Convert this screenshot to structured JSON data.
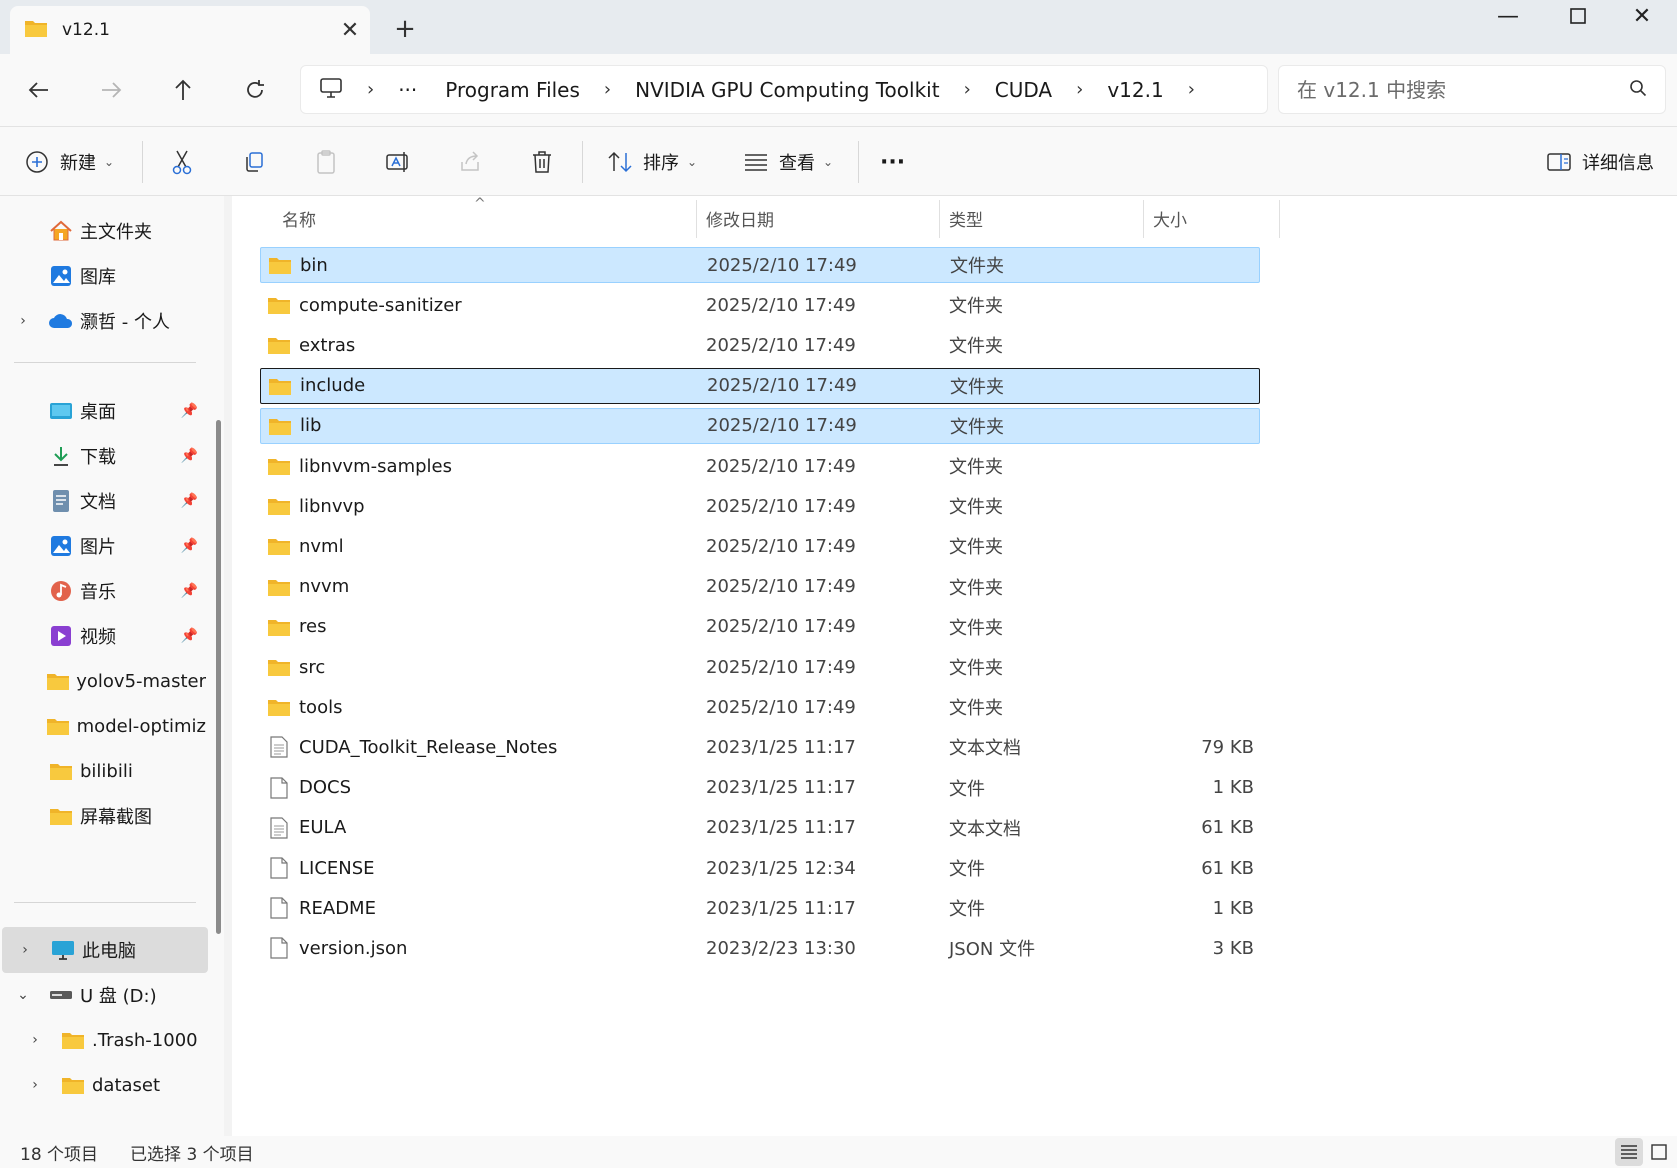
{
  "tab": {
    "title": "v12.1"
  },
  "address": {
    "crumbs": [
      "Program Files",
      "NVIDIA GPU Computing Toolkit",
      "CUDA",
      "v12.1"
    ],
    "ellipsis": "···"
  },
  "search": {
    "placeholder": "在 v12.1 中搜索"
  },
  "toolbar": {
    "new_label": "新建",
    "sort_label": "排序",
    "view_label": "查看",
    "more_label": "···",
    "details_label": "详细信息"
  },
  "sidebar": {
    "top": [
      {
        "label": "主文件夹",
        "icon": "home-icon"
      },
      {
        "label": "图库",
        "icon": "gallery-icon"
      },
      {
        "label": "灏哲 - 个人",
        "icon": "onedrive-icon"
      }
    ],
    "pinned": [
      {
        "label": "桌面",
        "icon": "desktop-icon"
      },
      {
        "label": "下载",
        "icon": "download-icon"
      },
      {
        "label": "文档",
        "icon": "documents-icon"
      },
      {
        "label": "图片",
        "icon": "pictures-icon"
      },
      {
        "label": "音乐",
        "icon": "music-icon"
      },
      {
        "label": "视频",
        "icon": "videos-icon"
      }
    ],
    "folders": [
      "yolov5-master",
      "model-optimiz",
      "bilibili",
      "屏幕截图"
    ],
    "drives": [
      {
        "label": "此电脑",
        "icon": "this-pc-icon"
      },
      {
        "label": "U 盘 (D:)",
        "icon": "usb-drive-icon"
      }
    ],
    "drive_children": [
      ".Trash-1000",
      "dataset"
    ]
  },
  "columns": {
    "name": "名称",
    "date": "修改日期",
    "type": "类型",
    "size": "大小"
  },
  "files": [
    {
      "name": "bin",
      "date": "2025/2/10 17:49",
      "type": "文件夹",
      "size": "",
      "kind": "folder",
      "state": "selected"
    },
    {
      "name": "compute-sanitizer",
      "date": "2025/2/10 17:49",
      "type": "文件夹",
      "size": "",
      "kind": "folder",
      "state": ""
    },
    {
      "name": "extras",
      "date": "2025/2/10 17:49",
      "type": "文件夹",
      "size": "",
      "kind": "folder",
      "state": ""
    },
    {
      "name": "include",
      "date": "2025/2/10 17:49",
      "type": "文件夹",
      "size": "",
      "kind": "folder",
      "state": "focused"
    },
    {
      "name": "lib",
      "date": "2025/2/10 17:49",
      "type": "文件夹",
      "size": "",
      "kind": "folder",
      "state": "selected"
    },
    {
      "name": "libnvvm-samples",
      "date": "2025/2/10 17:49",
      "type": "文件夹",
      "size": "",
      "kind": "folder",
      "state": ""
    },
    {
      "name": "libnvvp",
      "date": "2025/2/10 17:49",
      "type": "文件夹",
      "size": "",
      "kind": "folder",
      "state": ""
    },
    {
      "name": "nvml",
      "date": "2025/2/10 17:49",
      "type": "文件夹",
      "size": "",
      "kind": "folder",
      "state": ""
    },
    {
      "name": "nvvm",
      "date": "2025/2/10 17:49",
      "type": "文件夹",
      "size": "",
      "kind": "folder",
      "state": ""
    },
    {
      "name": "res",
      "date": "2025/2/10 17:49",
      "type": "文件夹",
      "size": "",
      "kind": "folder",
      "state": ""
    },
    {
      "name": "src",
      "date": "2025/2/10 17:49",
      "type": "文件夹",
      "size": "",
      "kind": "folder",
      "state": ""
    },
    {
      "name": "tools",
      "date": "2025/2/10 17:49",
      "type": "文件夹",
      "size": "",
      "kind": "folder",
      "state": ""
    },
    {
      "name": "CUDA_Toolkit_Release_Notes",
      "date": "2023/1/25 11:17",
      "type": "文本文档",
      "size": "79 KB",
      "kind": "text",
      "state": ""
    },
    {
      "name": "DOCS",
      "date": "2023/1/25 11:17",
      "type": "文件",
      "size": "1 KB",
      "kind": "file",
      "state": ""
    },
    {
      "name": "EULA",
      "date": "2023/1/25 11:17",
      "type": "文本文档",
      "size": "61 KB",
      "kind": "text",
      "state": ""
    },
    {
      "name": "LICENSE",
      "date": "2023/1/25 12:34",
      "type": "文件",
      "size": "61 KB",
      "kind": "file",
      "state": ""
    },
    {
      "name": "README",
      "date": "2023/1/25 11:17",
      "type": "文件",
      "size": "1 KB",
      "kind": "file",
      "state": ""
    },
    {
      "name": "version.json",
      "date": "2023/2/23 13:30",
      "type": "JSON 文件",
      "size": "3 KB",
      "kind": "file",
      "state": ""
    }
  ],
  "status": {
    "count": "18 个项目",
    "selected": "已选择 3 个项目"
  },
  "colors": {
    "selection": "#cce8ff",
    "selection_border": "#99d1ff",
    "folder": "#f8c93e"
  }
}
